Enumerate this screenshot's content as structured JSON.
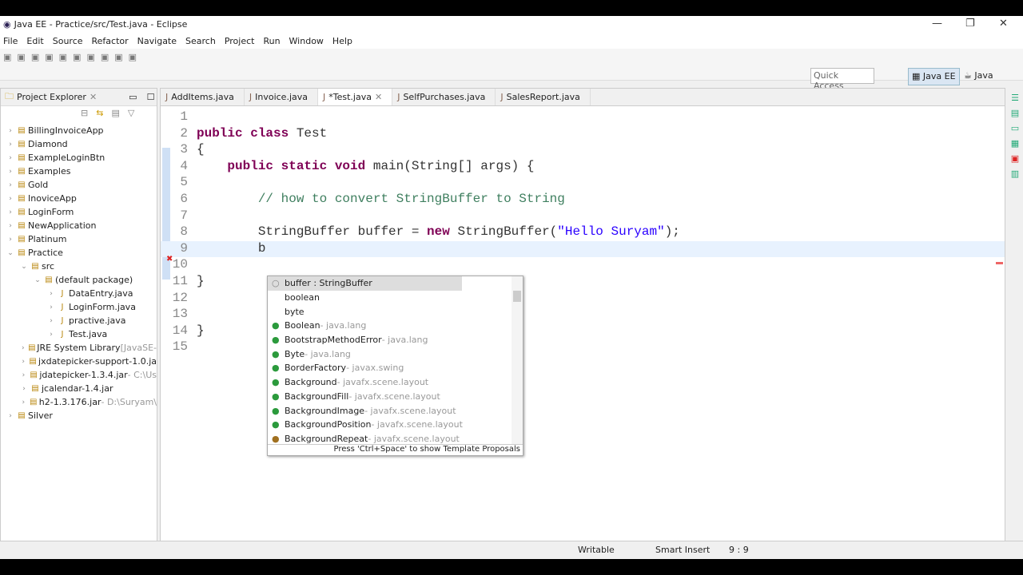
{
  "window": {
    "title": "Java EE - Practice/src/Test.java - Eclipse"
  },
  "menu": [
    "File",
    "Edit",
    "Source",
    "Refactor",
    "Navigate",
    "Search",
    "Project",
    "Run",
    "Window",
    "Help"
  ],
  "toolbar": {
    "quick_access_placeholder": "Quick Access",
    "perspectives": [
      "Java EE",
      "Java"
    ]
  },
  "explorer": {
    "title": "Project Explorer",
    "items": [
      {
        "label": "BillingInvoiceApp",
        "depth": 0,
        "open": false
      },
      {
        "label": "Diamond",
        "depth": 0,
        "open": false
      },
      {
        "label": "ExampleLoginBtn",
        "depth": 0,
        "open": false
      },
      {
        "label": "Examples",
        "depth": 0,
        "open": false
      },
      {
        "label": "Gold",
        "depth": 0,
        "open": false
      },
      {
        "label": "InoviceApp",
        "depth": 0,
        "open": false
      },
      {
        "label": "LoginForm",
        "depth": 0,
        "open": false
      },
      {
        "label": "NewApplication",
        "depth": 0,
        "open": false
      },
      {
        "label": "Platinum",
        "depth": 0,
        "open": false
      },
      {
        "label": "Practice",
        "depth": 0,
        "open": true
      },
      {
        "label": "src",
        "depth": 1,
        "open": true
      },
      {
        "label": "(default package)",
        "depth": 2,
        "open": true
      },
      {
        "label": "DataEntry.java",
        "depth": 3,
        "open": false
      },
      {
        "label": "LoginForm.java",
        "depth": 3,
        "open": false
      },
      {
        "label": "practive.java",
        "depth": 3,
        "open": false
      },
      {
        "label": "Test.java",
        "depth": 3,
        "open": false
      },
      {
        "label": "JRE System Library",
        "suffix": " [JavaSE-",
        "depth": 1,
        "open": false
      },
      {
        "label": "jxdatepicker-support-1.0.ja",
        "depth": 1,
        "open": false
      },
      {
        "label": "jdatepicker-1.3.4.jar",
        "suffix": " - C:\\Us",
        "depth": 1,
        "open": false
      },
      {
        "label": "jcalendar-1.4.jar",
        "depth": 1,
        "open": false
      },
      {
        "label": "h2-1.3.176.jar",
        "suffix": " - D:\\Suryam\\",
        "depth": 1,
        "open": false
      },
      {
        "label": "Silver",
        "depth": 0,
        "open": false
      }
    ]
  },
  "editor": {
    "tabs": [
      {
        "label": "AddItems.java"
      },
      {
        "label": "Invoice.java"
      },
      {
        "label": "*Test.java",
        "active": true
      },
      {
        "label": "SelfPurchases.java"
      },
      {
        "label": "SalesReport.java"
      }
    ],
    "lines": [
      {
        "n": "1",
        "html": ""
      },
      {
        "n": "2",
        "html": "<span class='kw'>public class</span> Test"
      },
      {
        "n": "3",
        "html": "{"
      },
      {
        "n": "4",
        "html": "    <span class='kw'>public static void</span> main(String[] args) {"
      },
      {
        "n": "5",
        "html": ""
      },
      {
        "n": "6",
        "html": "        <span class='cm'>// how to convert StringBuffer to String</span>"
      },
      {
        "n": "7",
        "html": ""
      },
      {
        "n": "8",
        "html": "        StringBuffer buffer = <span class='kw'>new</span> StringBuffer(<span class='str'>\"Hello Suryam\"</span>);"
      },
      {
        "n": "9",
        "html": "        b",
        "current": true
      },
      {
        "n": "10",
        "html": ""
      },
      {
        "n": "11",
        "html": "}"
      },
      {
        "n": "12",
        "html": ""
      },
      {
        "n": "13",
        "html": ""
      },
      {
        "n": "14",
        "html": "}"
      },
      {
        "n": "15",
        "html": ""
      }
    ]
  },
  "completion": {
    "items": [
      {
        "name": "buffer : StringBuffer",
        "pkg": "",
        "icon": "local-variable",
        "selected": true
      },
      {
        "name": "boolean",
        "pkg": "",
        "icon": "none"
      },
      {
        "name": "byte",
        "pkg": "",
        "icon": "none"
      },
      {
        "name": "Boolean",
        "pkg": " - java.lang",
        "icon": "class"
      },
      {
        "name": "BootstrapMethodError",
        "pkg": " - java.lang",
        "icon": "class"
      },
      {
        "name": "Byte",
        "pkg": " - java.lang",
        "icon": "class"
      },
      {
        "name": "BorderFactory",
        "pkg": " - javax.swing",
        "icon": "class"
      },
      {
        "name": "Background",
        "pkg": " - javafx.scene.layout",
        "icon": "class"
      },
      {
        "name": "BackgroundFill",
        "pkg": " - javafx.scene.layout",
        "icon": "class"
      },
      {
        "name": "BackgroundImage",
        "pkg": " - javafx.scene.layout",
        "icon": "class"
      },
      {
        "name": "BackgroundPosition",
        "pkg": " - javafx.scene.layout",
        "icon": "class"
      },
      {
        "name": "BackgroundRepeat",
        "pkg": " - javafx.scene.layout",
        "icon": "enum"
      }
    ],
    "footer": "Press 'Ctrl+Space' to show Template Proposals"
  },
  "status": {
    "writable": "Writable",
    "insert_mode": "Smart Insert",
    "position": "9 : 9"
  }
}
